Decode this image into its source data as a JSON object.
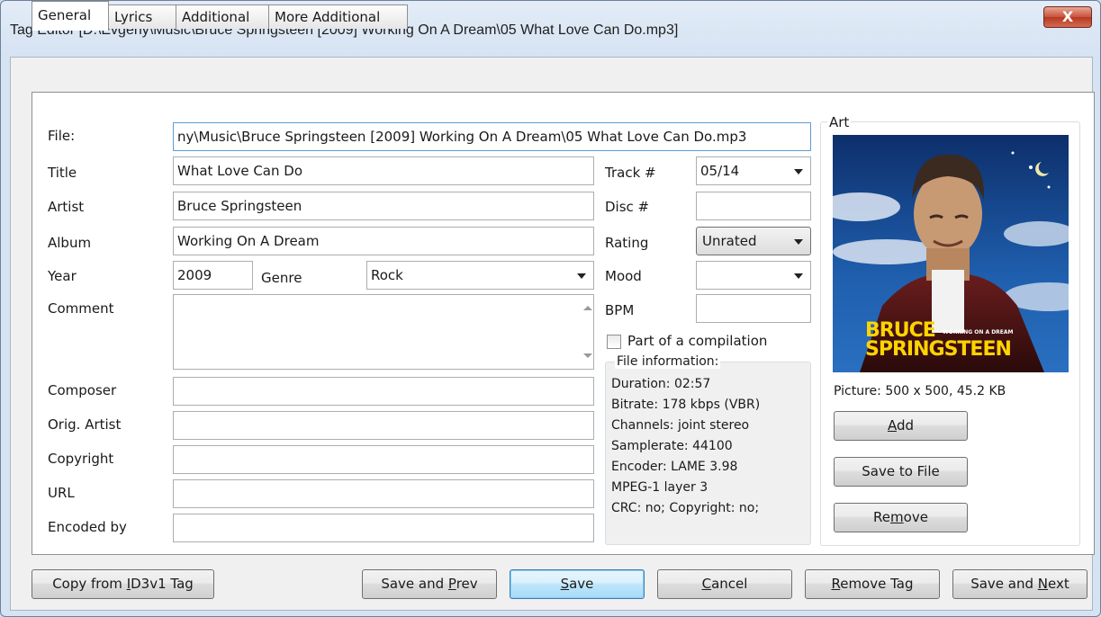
{
  "window": {
    "title": "Tag Editor [D:\\Evgeny\\Music\\Bruce Springsteen [2009] Working On A Dream\\05 What Love Can Do.mp3]",
    "close_glyph": "X"
  },
  "tabs": [
    "General",
    "Lyrics",
    "Additional",
    "More Additional"
  ],
  "form": {
    "file_label": "File:",
    "file_value": "ny\\Music\\Bruce Springsteen [2009] Working On A Dream\\05 What Love Can Do.mp3",
    "title_label": "Title",
    "title_value": "What Love Can Do",
    "artist_label": "Artist",
    "artist_value": "Bruce Springsteen",
    "album_label": "Album",
    "album_value": "Working On A Dream",
    "year_label": "Year",
    "year_value": "2009",
    "genre_label": "Genre",
    "genre_value": "Rock",
    "comment_label": "Comment",
    "comment_value": "",
    "composer_label": "Composer",
    "orig_artist_label": "Orig. Artist",
    "copyright_label": "Copyright",
    "url_label": "URL",
    "encoded_by_label": "Encoded by",
    "track_label": "Track #",
    "track_value": "05/14",
    "disc_label": "Disc #",
    "disc_value": "",
    "rating_label": "Rating",
    "rating_value": "Unrated",
    "mood_label": "Mood",
    "mood_value": "",
    "bpm_label": "BPM",
    "bpm_value": "",
    "compilation_label": "Part of a compilation",
    "compilation_checked": false
  },
  "file_info": {
    "legend": "File information:",
    "lines": [
      "Duration: 02:57",
      "Bitrate: 178 kbps (VBR)",
      "Channels: joint stereo",
      "Samplerate: 44100",
      "Encoder: LAME 3.98",
      "MPEG-1 layer 3",
      "CRC: no; Copyright: no;"
    ]
  },
  "art": {
    "legend": "Art",
    "cover_text_line1": "BRUCE",
    "cover_text_line2": "SPRINGSTEEN",
    "cover_subtitle": "WORKING ON A DREAM",
    "picture_info": "Picture: 500 x 500, 45.2 KB",
    "buttons": {
      "add_pre": "",
      "add_key": "A",
      "add_post": "dd",
      "save_to_file": "Save to File",
      "remove_pre": "Re",
      "remove_key": "m",
      "remove_post": "ove"
    }
  },
  "bottom_buttons": {
    "copy_pre": "Copy from ",
    "copy_key": "I",
    "copy_post": "D3v1 Tag",
    "prev_pre": "Save and ",
    "prev_key": "P",
    "prev_post": "rev",
    "save_pre": "",
    "save_key": "S",
    "save_post": "ave",
    "cancel_pre": "",
    "cancel_key": "C",
    "cancel_post": "ancel",
    "remove_pre": "",
    "remove_key": "R",
    "remove_post": "emove Tag",
    "next_pre": "Save and ",
    "next_key": "N",
    "next_post": "ext"
  },
  "colors": {
    "window_frame": "#d6e3f3",
    "close_button": "#c9513b",
    "default_button": "#bee6fd",
    "focus_border": "#5d9bd9"
  }
}
